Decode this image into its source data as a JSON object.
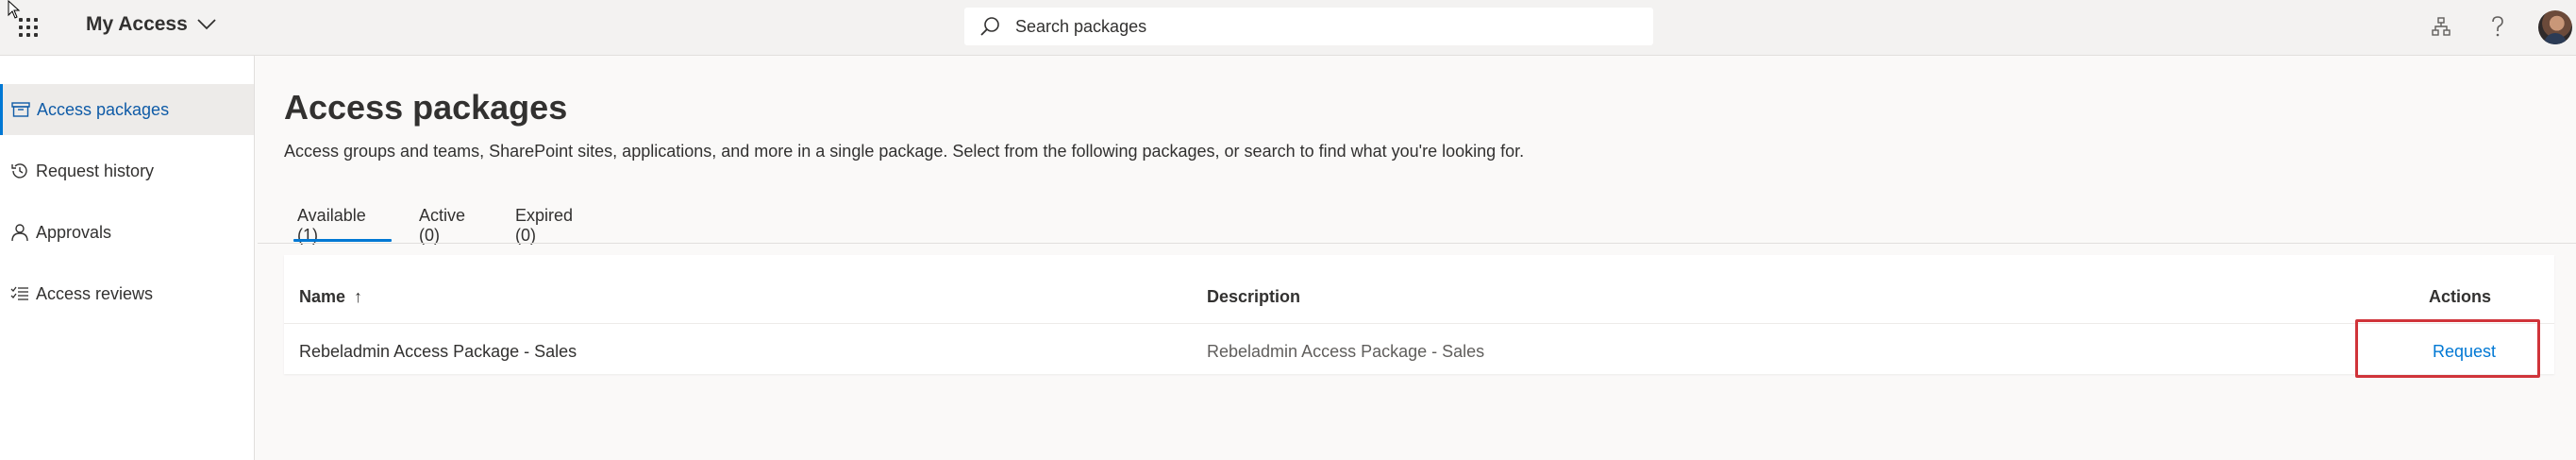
{
  "header": {
    "app_title": "My Access",
    "search_placeholder": "Search packages"
  },
  "sidebar": {
    "items": [
      {
        "label": "Access packages",
        "icon": "package-icon",
        "active": true
      },
      {
        "label": "Request history",
        "icon": "history-icon",
        "active": false
      },
      {
        "label": "Approvals",
        "icon": "person-icon",
        "active": false
      },
      {
        "label": "Access reviews",
        "icon": "checklist-icon",
        "active": false
      }
    ]
  },
  "main": {
    "title": "Access packages",
    "description": "Access groups and teams, SharePoint sites, applications, and more in a single package. Select from the following packages, or search to find what you're looking for.",
    "tabs": [
      {
        "label": "Available (1)",
        "active": true
      },
      {
        "label": "Active (0)",
        "active": false
      },
      {
        "label": "Expired (0)",
        "active": false
      }
    ],
    "table": {
      "columns": {
        "name": "Name",
        "description": "Description",
        "actions": "Actions"
      },
      "sort_indicator": "↑",
      "rows": [
        {
          "name": "Rebeladmin Access Package - Sales",
          "description": "Rebeladmin Access Package - Sales",
          "action": "Request"
        }
      ]
    }
  },
  "colors": {
    "accent": "#0078d4",
    "highlight_box": "#d0343a"
  }
}
